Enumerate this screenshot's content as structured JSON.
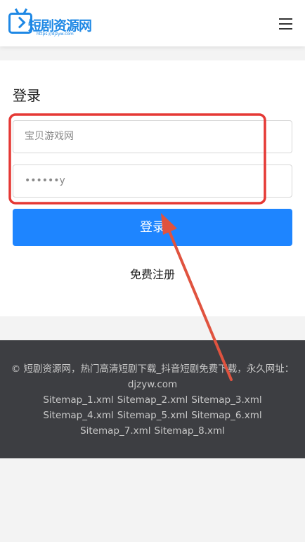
{
  "header": {
    "logo_text": "短剧资源网",
    "logo_subtext": "https://djzyw.com",
    "menu_icon": "hamburger-menu-icon"
  },
  "login": {
    "title": "登录",
    "username_value": "宝贝游戏网",
    "password_value": "••••••y",
    "submit_label": "登录",
    "register_label": "免费注册"
  },
  "footer": {
    "copyright": "© 短剧资源网，热门高清短剧下载_抖音短剧免费下载，永久网址：djzyw.com",
    "sitemaps": [
      "Sitemap_1.xml",
      "Sitemap_2.xml",
      "Sitemap_3.xml",
      "Sitemap_4.xml",
      "Sitemap_5.xml",
      "Sitemap_6.xml",
      "Sitemap_7.xml",
      "Sitemap_8.xml"
    ]
  },
  "annotation": {
    "highlight_color": "#e53935",
    "arrow_color": "#e0533f"
  },
  "colors": {
    "brand": "#1e88e5",
    "button": "#1e85ff",
    "footer_bg": "#3d3e42"
  }
}
